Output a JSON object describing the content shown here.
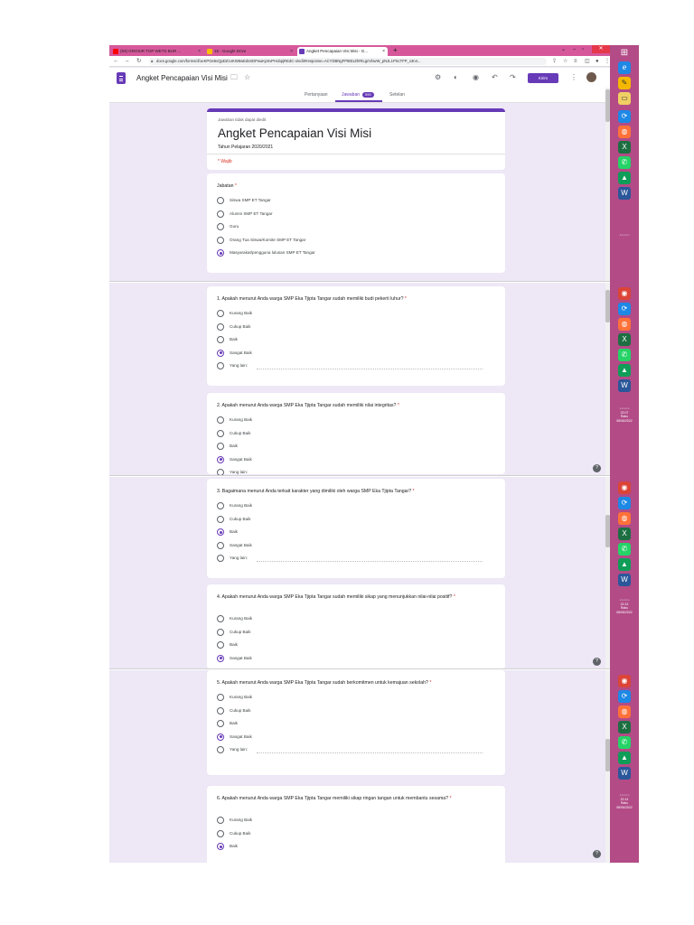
{
  "browser": {
    "tabs": [
      {
        "label": "(93) GROSIR TOP WETS BUR ...",
        "active": false
      },
      {
        "label": "15 - Google Drive",
        "active": false
      },
      {
        "label": "Angket Pencapaian Visi Misi - G...",
        "active": true
      }
    ],
    "url": "docs.google.com/forms/d/1eKPOe6vQpDZ1nKW6wEdsSDPwuKpSvPHobpjREdC-o/edit#response=ACYDBNgFP6tExZhRtLgnVbwW_pNJL1PScTFP_x3n4..."
  },
  "form_header": {
    "title": "Angket Pencapaian Visi Misi",
    "send_label": "Kirim",
    "tabs": [
      "Pertanyaan",
      "Jawaban",
      "Setelan"
    ],
    "response_count": "590"
  },
  "form": {
    "notice": "Jawaban tidak dapat diedit",
    "title": "Angket Pencapaian Visi Misi",
    "description": "Tahun Pelajaran 2020/2021",
    "required": "* Wajib"
  },
  "questions": [
    {
      "text": "Jabatan",
      "options": [
        "Siswa SMP ET Tangar",
        "Alumni SMP ET Tangar",
        "Guru",
        "Orang Tua Siswa/Komite SMP ET Tangar",
        "Masyarakat/pengguna lulusan SMP ET Tangar"
      ],
      "selected": 4,
      "other": false
    },
    {
      "text": "1. Apakah menurut Anda warga SMP Eka Tjipta Tangar sudah memiliki budi pekerti luhur?",
      "options": [
        "Kurang Baik",
        "Cukup Baik",
        "Baik",
        "Sangat Baik"
      ],
      "selected": 3,
      "other": true
    },
    {
      "text": "2. Apakah menurut Anda warga SMP Eka Tjipta Tangar sudah memiliki nilai integritas?",
      "options": [
        "Kurang Baik",
        "Cukup Baik",
        "Baik",
        "Sangat Baik"
      ],
      "selected": 3,
      "other": false,
      "cut": "Yang lain:"
    },
    {
      "text": "3. Bagaimana menurut Anda terkait karakter yang dimiliki oleh warga SMP Eka Tjipta Tangar?",
      "options": [
        "Kurang Baik",
        "Cukup Baik",
        "Baik",
        "Sangat Baik"
      ],
      "selected": 2,
      "other": true
    },
    {
      "text": "4. Apakah menurut Anda warga SMP Eka Tjipta Tangar sudah memiliki sikap yang menunjukkan nilai-nilai positif?",
      "options": [
        "Kurang Baik",
        "Cukup Baik",
        "Baik",
        "Sangat Baik"
      ],
      "selected": 3,
      "other": false
    },
    {
      "text": "5. Apakah menurut Anda warga SMP Eka Tjipta Tangar sudah berkomitmen untuk kemajuan sekolah?",
      "options": [
        "Kurang Baik",
        "Cukup Baik",
        "Baik",
        "Sangat Baik"
      ],
      "selected": 3,
      "other": true
    },
    {
      "text": "6. Apakah menurut Anda warga SMP Eka Tjipta Tangar memiliki sikap ringan tangan untuk membantu sesama?",
      "options": [
        "Kurang Baik",
        "Cukup Baik",
        "Baik"
      ],
      "selected": 2,
      "other": false
    }
  ],
  "other_label": "Yang lain:",
  "taskbar": {
    "clock": [
      {
        "time": "22:07",
        "day": "Rabu",
        "date": "08/06/2022"
      },
      {
        "time": "22:13",
        "day": "Rabu",
        "date": "08/06/2022"
      },
      {
        "time": "22:14",
        "day": "Rabu",
        "date": "08/06/2022"
      }
    ]
  },
  "colors": {
    "accent": "#673ab7",
    "background": "#ede7f6",
    "tabbar": "#d6589b",
    "taskbar": "#b24b86",
    "required": "#d93025"
  }
}
